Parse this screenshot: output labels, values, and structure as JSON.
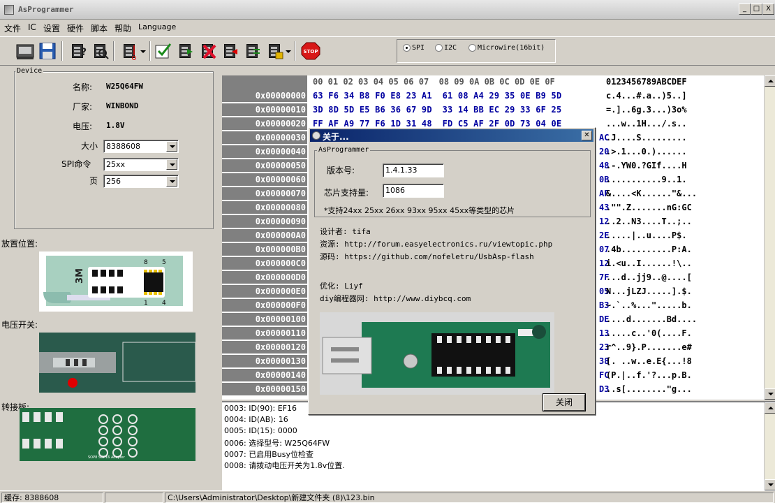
{
  "window": {
    "title": "AsProgrammer",
    "min": "_",
    "max": "□",
    "close": "X"
  },
  "menu": [
    "文件",
    "IC",
    "设置",
    "硬件",
    "脚本",
    "帮助",
    "Language"
  ],
  "toolbar": {
    "stop_label": "STOP"
  },
  "protocols": [
    {
      "label": "SPI",
      "selected": true
    },
    {
      "label": "I2C",
      "selected": false
    },
    {
      "label": "Microwire(16bit)",
      "selected": false
    }
  ],
  "device": {
    "legend": "Device",
    "name_label": "名称:",
    "name_value": "W25Q64FW",
    "vendor_label": "厂家:",
    "vendor_value": "WINBOND",
    "voltage_label": "电压:",
    "voltage_value": "1.8V",
    "size_label": "大小",
    "size_value": "8388608",
    "spi_label": "SPI命令",
    "spi_value": "25xx",
    "page_label": "页",
    "page_value": "256"
  },
  "left_sections": {
    "placement": "放置位置:",
    "voltage_switch": "电压开关:",
    "adapter": "转接板:"
  },
  "left_images": {
    "chip_text": "3M",
    "pin8": "8",
    "pin5": "5",
    "pin1": "1",
    "pin4": "4",
    "switch_text": "SOP8 SOP16 Adapter"
  },
  "hex": {
    "columns": "00 01 02 03 04 05 06 07  08 09 0A 0B 0C 0D 0E 0F",
    "ascii_header": "0123456789ABCDEF",
    "rows": [
      {
        "addr": "0x00000000",
        "bytes": "63 F6 34 B8 F0 E8 23 A1  61 08 A4 29 35 0E B9 5D",
        "ascii": "c.4...#.a..)5..]"
      },
      {
        "addr": "0x00000010",
        "bytes": "3D 8D 5D E5 B6 36 67 9D  33 14 BB EC 29 33 6F 25",
        "ascii": "=.]..6g.3...)3o%"
      },
      {
        "addr": "0x00000020",
        "bytes": "FF AF A9 77 F6 1D 31 48  FD C5 AF 2F 0D 73 04 0E",
        "ascii": "...w..1H.../.s.."
      },
      {
        "addr": "0x00000030",
        "bytes": "",
        "last": "AC",
        "ascii": ".J....S........."
      },
      {
        "addr": "0x00000040",
        "bytes": "",
        "last": "20",
        "ascii": ".>.1...0.)......"
      },
      {
        "addr": "0x00000050",
        "bytes": "",
        "last": "48",
        "ascii": ".-.YW0.?GIf....H"
      },
      {
        "addr": "0x00000060",
        "bytes": "",
        "last": "0B",
        "ascii": "...........9..1."
      },
      {
        "addr": "0x00000070",
        "bytes": "",
        "last": "AF",
        "ascii": "&....<K......\"&..."
      },
      {
        "addr": "0x00000080",
        "bytes": "",
        "last": "43",
        "ascii": ".\"\".Z.......nG:GC"
      },
      {
        "addr": "0x00000090",
        "bytes": "",
        "last": "12",
        "ascii": "..2..N3....T..;.."
      },
      {
        "addr": "0x000000A0",
        "bytes": "",
        "last": "2E",
        "ascii": ".....|..u....P$."
      },
      {
        "addr": "0x000000B0",
        "bytes": "",
        "last": "07",
        "ascii": ".4b..........P:A."
      },
      {
        "addr": "0x000000C0",
        "bytes": "",
        "last": "12",
        "ascii": "i.<u..I......!\\.."
      },
      {
        "addr": "0x000000D0",
        "bytes": "",
        "last": "7F",
        "ascii": "...d..jj9..@....["
      },
      {
        "addr": "0x000000E0",
        "bytes": "",
        "last": "05",
        "ascii": "N...jLZJ.....].$."
      },
      {
        "addr": "0x000000F0",
        "bytes": "",
        "last": "B3",
        "ascii": "~.`..%...\".....b."
      },
      {
        "addr": "0x00000100",
        "bytes": "",
        "last": "DE",
        "ascii": "....d.......Bd...."
      },
      {
        "addr": "0x00000110",
        "bytes": "",
        "last": "13",
        "ascii": ".....c..'0(....F."
      },
      {
        "addr": "0x00000120",
        "bytes": "",
        "last": "23",
        "ascii": "r^..9}.P.......e#"
      },
      {
        "addr": "0x00000130",
        "bytes": "",
        "last": "38",
        "ascii": "[. ..w..e.E{...!8"
      },
      {
        "addr": "0x00000140",
        "bytes": "",
        "last": "FC",
        "ascii": "(P.|..f.'?...p.B."
      },
      {
        "addr": "0x00000150",
        "bytes": "",
        "last": "D3",
        "ascii": "..s[........\"g..."
      }
    ]
  },
  "log": [
    "0003: ID(90): EF16",
    "0004: ID(AB): 16",
    "0005: ID(15): 0000",
    "0006: 选择型号: W25Q64FW",
    "0007: 已启用Busy位检查",
    "0008: 请拨动电压开关为1.8v位置."
  ],
  "status": {
    "cache": "缓存: 8388608",
    "empty": "",
    "path": "C:\\Users\\Administrator\\Desktop\\新建文件夹 (8)\\123.bin"
  },
  "about": {
    "title": "关于...",
    "group_legend": "AsProgrammer",
    "version_label": "版本号:",
    "version_value": "1.4.1.33",
    "chips_label": "芯片支持量:",
    "chips_value": "1086",
    "support_note": "*支持24xx 25xx 26xx 93xx 95xx 45xx等类型的芯片",
    "designer": "设计者: tifa",
    "resource": "资源: http://forum.easyelectronics.ru/viewtopic.php",
    "source": "源码: https://github.com/nofeletru/UsbAsp-flash",
    "optimizer": "优化: Liyf",
    "site": "diy编程器网: http://www.diybcq.com",
    "close_label": "关闭"
  }
}
